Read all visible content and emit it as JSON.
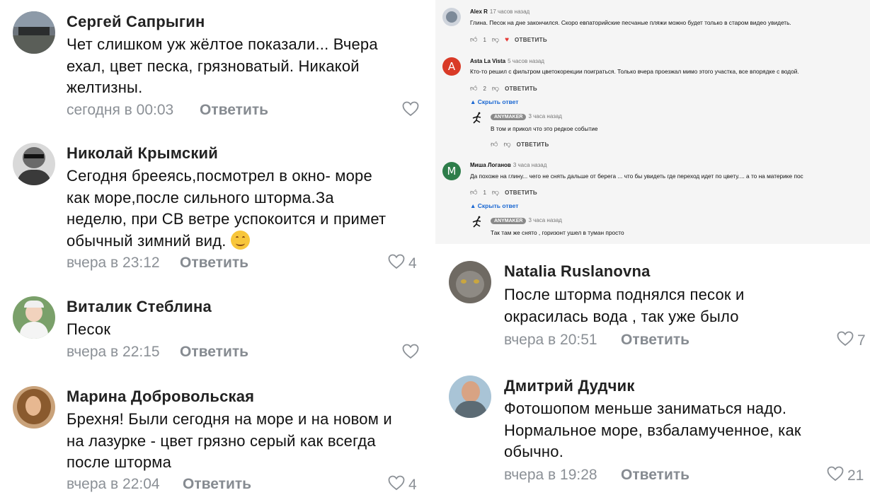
{
  "left_comments": [
    {
      "name": "Сергей Сапрыгин",
      "lines": [
        "Чет слишком уж жёлтое показали... Вчера",
        "ехал, цвет песка, грязноватый. Никакой",
        "желтизны."
      ],
      "time": "сегодня в 00:03",
      "reply": "Ответить",
      "likes": ""
    },
    {
      "name": "Николай Крымский",
      "lines": [
        "Сегодня брееясь,посмотрел в окно- море",
        "как море,после сильного шторма.За",
        "неделю, при СВ ветре успокоится и примет",
        "обычный зимний вид."
      ],
      "time": "вчера в 23:12",
      "reply": "Ответить",
      "likes": "4"
    },
    {
      "name": "Виталик Стеблина",
      "lines": [
        "Песок"
      ],
      "time": "вчера в 22:15",
      "reply": "Ответить",
      "likes": ""
    },
    {
      "name": "Марина Добровольская",
      "lines": [
        "Брехня! Были сегодня на море и на новом и",
        "на лазурке - цвет грязно серый как всегда",
        "после шторма"
      ],
      "time": "вчера в 22:04",
      "reply": "Ответить",
      "likes": "4"
    }
  ],
  "right_comments": [
    {
      "name": "Natalia Ruslanovna",
      "lines": [
        "После шторма поднялся песок и",
        "окрасилась вода , так уже было"
      ],
      "time": "вчера в 20:51",
      "reply": "Ответить",
      "likes": "7"
    },
    {
      "name": "Дмитрий Дудчик",
      "lines": [
        "Фотошопом меньше заниматься надо.",
        "Нормальное море, взбаламученное, как",
        "обычно."
      ],
      "time": "вчера в 19:28",
      "reply": "Ответить",
      "likes": "21"
    }
  ],
  "yt": {
    "reply_label": "ОТВЕТИТЬ",
    "hide_label": "Скрыть ответ",
    "badge": "ANYMAKER",
    "comments": [
      {
        "avatar_letter": "",
        "name": "Alex R",
        "time": "17 часов назад",
        "text": "Глина. Песок на дне закончился. Скоро  евпаторийские песчаные пляжи можно будет только в старом видео увидеть.",
        "likes": "1"
      },
      {
        "avatar_letter": "A",
        "name": "Asta La Vista",
        "time": "5 часов назад",
        "text": "Кто-то решил с фильтром цветокорекции поиграться. Только вчера проезжал мимо этого участка, все впорядке с водой.",
        "likes": "2"
      },
      {
        "name": "",
        "time": "3 часа назад",
        "text": "В том и прикол что это редкое событие",
        "likes": ""
      },
      {
        "avatar_letter": "M",
        "name": "Миша Логанов",
        "time": "3 часа назад",
        "text": "Да похоже на глину...  чего не снять дальше от берега  ... что  бы увидеть где переход идет по цвету.... а то на материке пос",
        "likes": "1"
      },
      {
        "name": "",
        "time": "3 часа назад",
        "text": "Так там же снято , горизонт ушел в туман просто",
        "likes": ""
      }
    ]
  },
  "colors": {
    "asta_avatar": "#d93a27",
    "misha_avatar": "#2e7d4a",
    "link_blue": "#1967d2"
  }
}
